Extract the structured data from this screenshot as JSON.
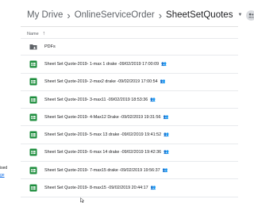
{
  "breadcrumb": {
    "root": "My Drive",
    "parent": "OnlineServiceOrder",
    "current": "SheetSetQuotes"
  },
  "list": {
    "header_name": "Name"
  },
  "left_sidebar_fragments": [
    "ised",
    "ge"
  ],
  "rows": [
    {
      "type": "folder",
      "label": "PDFs"
    },
    {
      "type": "sheet",
      "label": "Sheet Set Quote-2019- 1-max 1 drake -09/02/2019 17:00:09",
      "shared": "👥"
    },
    {
      "type": "sheet",
      "label": "Sheet Set Quote-2019- 2-max2 drake -09/02/2019 17:00:54",
      "shared": "👥"
    },
    {
      "type": "sheet",
      "label": "Sheet Set Quote-2019- 3-max11 -09/02/2019 18:53:36",
      "shared": "👥"
    },
    {
      "type": "sheet",
      "label": "Sheet Set Quote-2019- 4-Max12 Drake -09/02/2019 19:31:56",
      "shared": "👥"
    },
    {
      "type": "sheet",
      "label": "Sheet Set Quote-2019- 5-max 13 drake -09/02/2019 19:41:52",
      "shared": "👥"
    },
    {
      "type": "sheet",
      "label": "Sheet Set Quote-2019- 6-max 14 drake -09/02/2019 19:42:36",
      "shared": "👥"
    },
    {
      "type": "sheet",
      "label": "Sheet Set Quote-2019- 7-max15 drake -09/02/2019 19:56:37",
      "shared": "👥"
    },
    {
      "type": "sheet",
      "label": "Sheet Set Quote-2019- 8-max15 -09/02/2019 20:44:17",
      "shared": "👥"
    }
  ],
  "colors": {
    "sheets_green": "#1e8e3e",
    "folder_gray": "#5f6368",
    "text": "#202124",
    "muted": "#5f6368"
  }
}
